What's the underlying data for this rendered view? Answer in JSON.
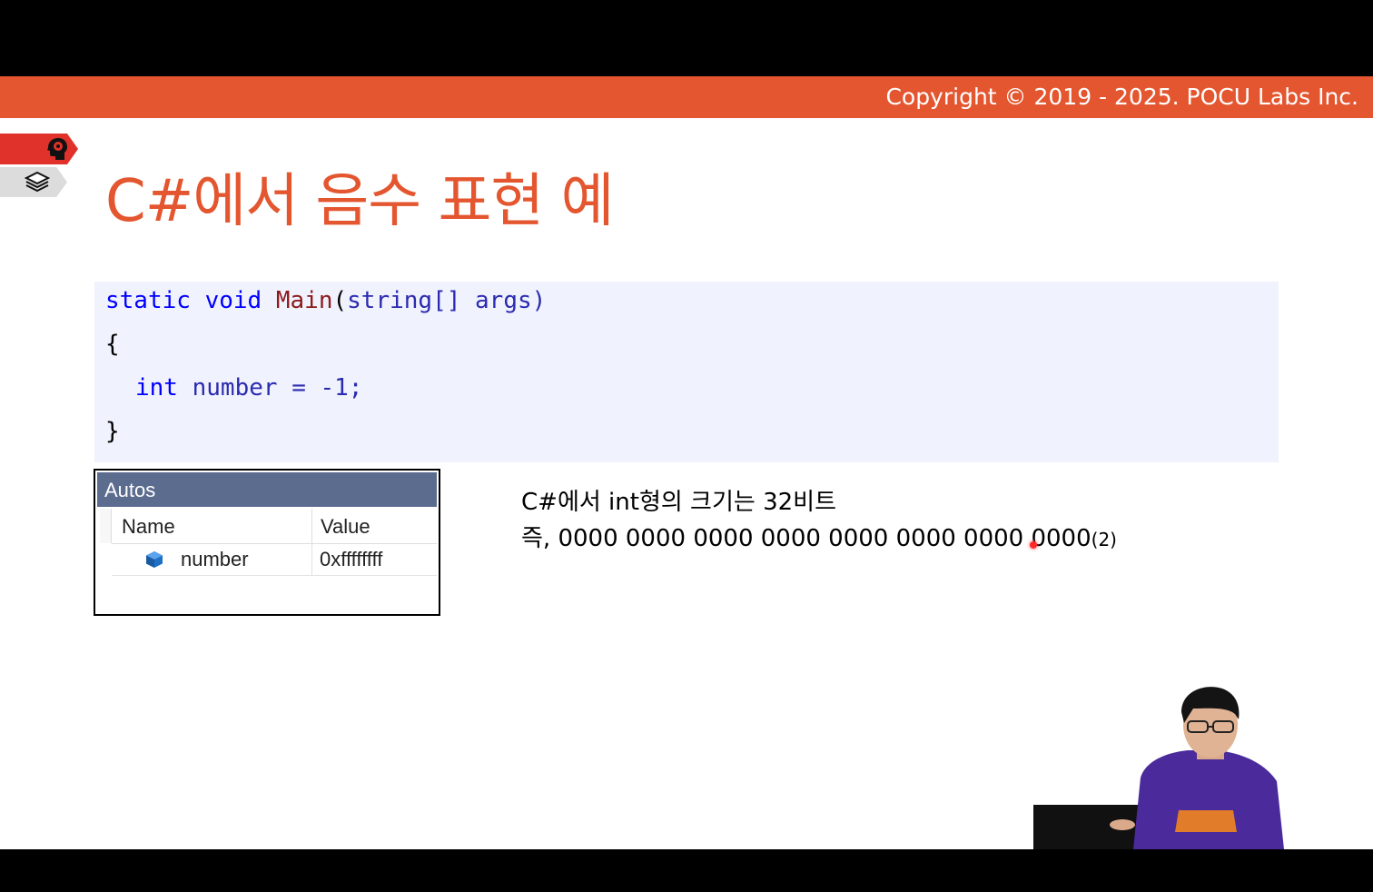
{
  "banner": {
    "copyright": "Copyright © 2019 - 2025. POCU Labs Inc."
  },
  "slide": {
    "title": "C#에서 음수 표현 예"
  },
  "code": {
    "line1": {
      "kw1": "static",
      "kw2": "void",
      "fn": "Main",
      "open": "(",
      "type": "string",
      "rest": "[] args)"
    },
    "line2": "{",
    "line3": {
      "kw": "int",
      "rest": " number = -1;"
    },
    "line4": "}"
  },
  "autos": {
    "title": "Autos",
    "columns": [
      "Name",
      "Value"
    ],
    "rows": [
      {
        "name": "number",
        "value": "0xffffffff"
      }
    ]
  },
  "note": {
    "line1": "C#에서 int형의 크기는 32비트",
    "line2": "즉, 0000 0000 0000 0000 0000 0000 0000 0000",
    "line2_sub": "(2)"
  },
  "colors": {
    "accent": "#e4562f",
    "code_bg": "#f0f2fd",
    "autos_header": "#5b6c8f",
    "keyword": "#0000ff"
  },
  "icons": [
    "brain-icon",
    "layers-icon",
    "variable-cube-icon"
  ]
}
